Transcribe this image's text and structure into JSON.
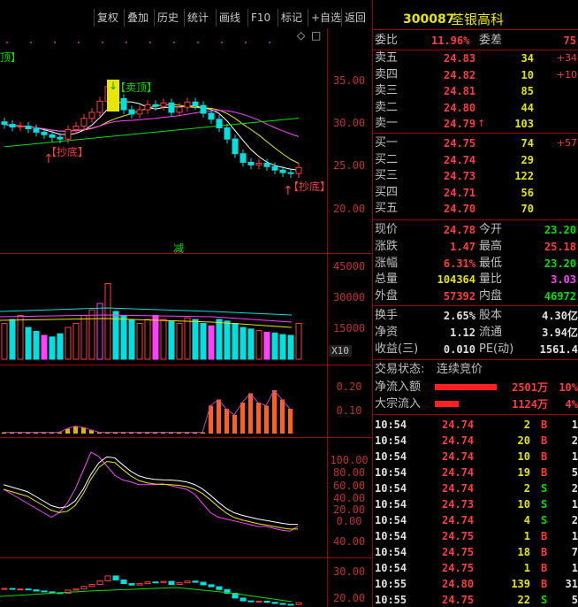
{
  "toolbar": {
    "buttons": [
      "复权",
      "叠加",
      "历史",
      "统计",
      "画线",
      "F10",
      "标记",
      "+自选",
      "返回"
    ]
  },
  "chart": {
    "price_axis": [
      "35.00",
      "30.00",
      "25.00",
      "20.00"
    ],
    "volume_axis": [
      "45000",
      "30000",
      "15000"
    ],
    "volume_unit": "X10",
    "ind1_axis": [
      "0.20",
      "0.10"
    ],
    "ind2_axis": [
      "100.00",
      "80.00",
      "60.00",
      "40.00",
      "20.00",
      "0.00"
    ],
    "ind3_axis": [
      "40.00",
      "30.00",
      "20.00"
    ],
    "ann_sell_top": "卖顶",
    "ann_bottom_1": "抄底",
    "ann_bottom_2": "抄底",
    "ann_reduce": "减",
    "ann_left": "顶"
  },
  "stock": {
    "code": "300087",
    "name": "荃银高科",
    "ratio_label": "委比",
    "ratio": "11.96%",
    "diff_label": "委差",
    "diff": "75"
  },
  "asks": [
    {
      "label": "卖五",
      "price": "24.83",
      "vol": "34",
      "chg": "+34"
    },
    {
      "label": "卖四",
      "price": "24.82",
      "vol": "10",
      "chg": "+10"
    },
    {
      "label": "卖三",
      "price": "24.81",
      "vol": "85",
      "chg": ""
    },
    {
      "label": "卖二",
      "price": "24.80",
      "vol": "44",
      "chg": ""
    },
    {
      "label": "卖一",
      "price": "24.79",
      "vol": "103",
      "chg": ""
    }
  ],
  "bids": [
    {
      "label": "买一",
      "price": "24.75",
      "vol": "74",
      "chg": "+57"
    },
    {
      "label": "买二",
      "price": "24.74",
      "vol": "29",
      "chg": ""
    },
    {
      "label": "买三",
      "price": "24.73",
      "vol": "122",
      "chg": ""
    },
    {
      "label": "买四",
      "price": "24.71",
      "vol": "56",
      "chg": ""
    },
    {
      "label": "买五",
      "price": "24.70",
      "vol": "70",
      "chg": ""
    }
  ],
  "quote": [
    {
      "l1": "现价",
      "v1": "24.78",
      "c1": "red",
      "l2": "今开",
      "v2": "23.20",
      "c2": "grn"
    },
    {
      "l1": "涨跌",
      "v1": "1.47",
      "c1": "red",
      "l2": "最高",
      "v2": "25.18",
      "c2": "red"
    },
    {
      "l1": "涨幅",
      "v1": "6.31%",
      "c1": "red",
      "l2": "最低",
      "v2": "23.20",
      "c2": "grn"
    },
    {
      "l1": "总量",
      "v1": "104364",
      "c1": "yel",
      "l2": "量比",
      "v2": "3.03",
      "c2": "mag"
    },
    {
      "l1": "外盘",
      "v1": "57392",
      "c1": "red",
      "l2": "内盘",
      "v2": "46972",
      "c2": "grn"
    }
  ],
  "finance": [
    {
      "l1": "换手",
      "v1": "2.65%",
      "l2": "股本",
      "v2": "4.30亿"
    },
    {
      "l1": "净资",
      "v1": "1.12",
      "l2": "流通",
      "v2": "3.94亿"
    },
    {
      "l1": "收益(三)",
      "v1": "0.010",
      "l2": "PE(动)",
      "v2": "1561.4"
    }
  ],
  "status": {
    "label": "交易状态:",
    "value": "连续竞价"
  },
  "flow": [
    {
      "label": "净流入额",
      "amount": "2501万",
      "pct": "10%",
      "bar": 0.9
    },
    {
      "label": "大宗流入",
      "amount": "1124万",
      "pct": "4%",
      "bar": 0.35
    }
  ],
  "ticks": [
    {
      "t": "10:54",
      "p": "24.74",
      "v": "2",
      "s": "B",
      "n": "1"
    },
    {
      "t": "10:54",
      "p": "24.74",
      "v": "20",
      "s": "B",
      "n": "2"
    },
    {
      "t": "10:54",
      "p": "24.74",
      "v": "10",
      "s": "B",
      "n": "1"
    },
    {
      "t": "10:54",
      "p": "24.74",
      "v": "19",
      "s": "B",
      "n": "5"
    },
    {
      "t": "10:54",
      "p": "24.74",
      "v": "2",
      "s": "S",
      "n": "2"
    },
    {
      "t": "10:54",
      "p": "24.73",
      "v": "10",
      "s": "S",
      "n": "1"
    },
    {
      "t": "10:54",
      "p": "24.74",
      "v": "4",
      "s": "S",
      "n": "2"
    },
    {
      "t": "10:54",
      "p": "24.75",
      "v": "1",
      "s": "B",
      "n": "1"
    },
    {
      "t": "10:54",
      "p": "24.75",
      "v": "18",
      "s": "B",
      "n": "7"
    },
    {
      "t": "10:54",
      "p": "24.75",
      "v": "1",
      "s": "B",
      "n": "1"
    },
    {
      "t": "10:55",
      "p": "24.80",
      "v": "139",
      "s": "B",
      "n": "31"
    },
    {
      "t": "10:55",
      "p": "24.75",
      "v": "22",
      "s": "S",
      "n": "5"
    }
  ],
  "colors": {
    "up": "#ff3b3b",
    "down": "#00e0e0",
    "frame": "#a00000",
    "ma5": "#ffffff",
    "ma10": "#e6e600",
    "ma20": "#ff40ff",
    "ma60": "#00e000"
  }
}
